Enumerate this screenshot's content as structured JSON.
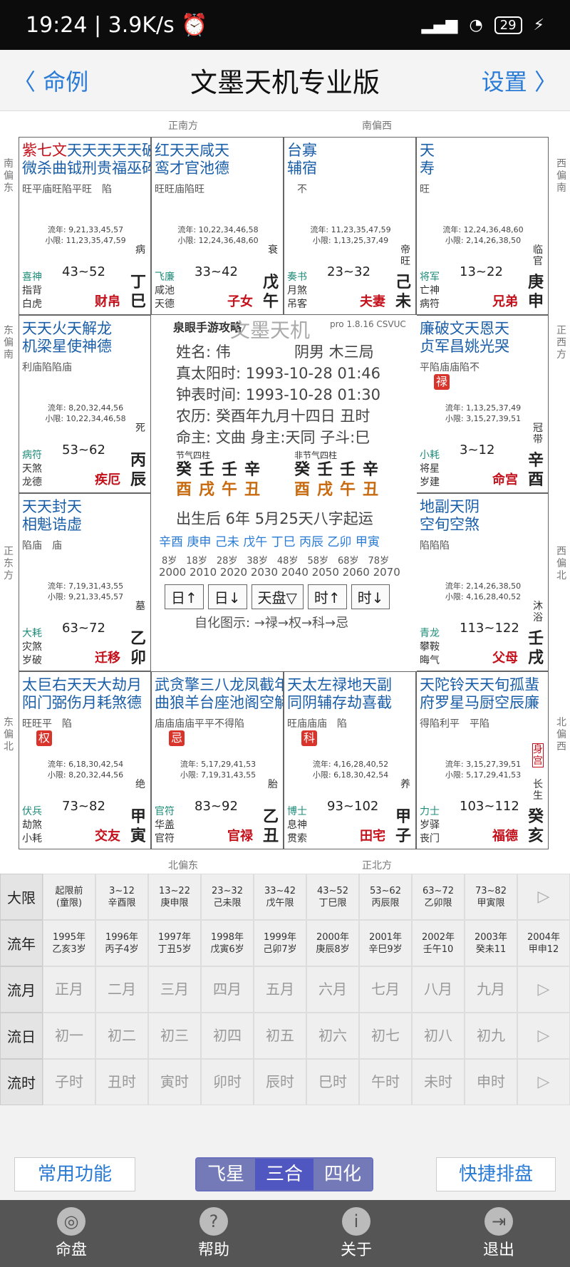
{
  "status": {
    "time": "19:24",
    "speed": "3.9K/s",
    "battery": "29"
  },
  "nav": {
    "back": "命例",
    "title": "文墨天机专业版",
    "settings": "设置"
  },
  "dirs": {
    "top1": "正南方",
    "top2": "南偏西",
    "bot1": "北偏东",
    "bot2": "正北方",
    "l1": "南偏东",
    "l2": "东偏南",
    "l3": "正东方",
    "l4": "东偏北",
    "r1": "西偏南",
    "r2": "正西方",
    "r3": "西偏北",
    "r4": "北偏西"
  },
  "cells": [
    {
      "main": "紫七文",
      "stars": "天天天天天破",
      "sub": "微杀曲钺刑贵福巫碎",
      "bright": "旺平庙旺陷平旺　陷",
      "flow1": "流年: 9,21,33,45,57",
      "flow2": "小限: 11,23,35,47,59",
      "range": "43~52",
      "g1": "喜神",
      "g2": "指背",
      "g3": "白虎",
      "pal": "财帛",
      "gz": "丁巳",
      "sm": "病"
    },
    {
      "main": "",
      "stars": "红天天咸天",
      "sub": "鸾才官池德",
      "bright": "旺旺庙陷旺",
      "flow1": "流年: 10,22,34,46,58",
      "flow2": "小限: 12,24,36,48,60",
      "range": "33~42",
      "g1": "飞廉",
      "g2": "咸池",
      "g3": "天德",
      "pal": "子女",
      "gz": "戊午",
      "sm": "衰"
    },
    {
      "main": "",
      "stars": "台寡",
      "sub": "辅宿",
      "bright": "　不",
      "flow1": "流年: 11,23,35,47,59",
      "flow2": "小限: 1,13,25,37,49",
      "range": "23~32",
      "g1": "奏书",
      "g2": "月煞",
      "g3": "吊客",
      "pal": "夫妻",
      "gz": "己未",
      "sm": "帝旺"
    },
    {
      "main": "",
      "stars": "天",
      "sub": "寿",
      "bright": "旺",
      "flow1": "流年: 12,24,36,48,60",
      "flow2": "小限: 2,14,26,38,50",
      "range": "13~22",
      "g1": "将军",
      "g2": "亡神",
      "g3": "病符",
      "pal": "兄弟",
      "gz": "庚申",
      "sm": "临官"
    },
    {
      "main": "",
      "stars": "天天火天解龙",
      "sub": "机梁星使神德",
      "bright": "利庙陷陷庙",
      "flow1": "流年: 8,20,32,44,56",
      "flow2": "小限: 10,22,34,46,58",
      "range": "53~62",
      "g1": "病符",
      "g2": "天煞",
      "g3": "龙德",
      "pal": "疾厄",
      "gz": "丙辰",
      "sm": "死"
    },
    {
      "main": "",
      "stars": "廉破文天恩天",
      "sub": "贞军昌姚光哭",
      "bright": "平陷庙庙陷不",
      "flow1": "流年: 1,13,25,37,49",
      "flow2": "小限: 3,15,27,39,51",
      "range": "3~12",
      "g1": "小耗",
      "g2": "将星",
      "g3": "岁建",
      "pal": "命宫",
      "gz": "辛酉",
      "sm": "冠带",
      "badge": "禄"
    },
    {
      "main": "",
      "stars": "天天封天",
      "sub": "相魁诰虚",
      "bright": "陷庙　庙",
      "flow1": "流年: 7,19,31,43,55",
      "flow2": "小限: 9,21,33,45,57",
      "range": "63~72",
      "g1": "大耗",
      "g2": "灾煞",
      "g3": "岁破",
      "pal": "迁移",
      "gz": "乙卯",
      "sm": "墓"
    },
    {
      "main": "",
      "stars": "地副天阴",
      "sub": "空旬空煞",
      "bright": "陷陷陷",
      "flow1": "流年: 2,14,26,38,50",
      "flow2": "小限: 4,16,28,40,52",
      "range": "113~122",
      "g1": "青龙",
      "g2": "攀鞍",
      "g3": "晦气",
      "pal": "父母",
      "gz": "壬戌",
      "sm": "沐浴"
    },
    {
      "main": "",
      "stars": "太巨右天天大劫月",
      "sub": "阳门弼伤月耗煞德",
      "bright": "旺旺平　陷",
      "flow1": "流年: 6,18,30,42,54",
      "flow2": "小限: 8,20,32,44,56",
      "range": "73~82",
      "g1": "伏兵",
      "g2": "劫煞",
      "g3": "小耗",
      "pal": "交友",
      "gz": "甲寅",
      "sm": "绝",
      "badge": "权"
    },
    {
      "main": "",
      "stars": "武贪擎三八龙凤截年华",
      "sub": "曲狼羊台座池阁空解盖",
      "bright": "庙庙庙庙平平不得陷",
      "flow1": "流年: 5,17,29,41,53",
      "flow2": "小限: 7,19,31,43,55",
      "range": "83~92",
      "g1": "官符",
      "g2": "华盖",
      "g3": "官符",
      "pal": "官禄",
      "gz": "乙丑",
      "sm": "胎",
      "badge": "忌"
    },
    {
      "main": "",
      "stars": "天太左禄地天副",
      "sub": "同阴辅存劫喜截",
      "bright": "旺庙庙庙　陷",
      "flow1": "流年: 4,16,28,40,52",
      "flow2": "小限: 6,18,30,42,54",
      "range": "93~102",
      "g1": "博士",
      "g2": "息神",
      "g3": "贯索",
      "pal": "田宅",
      "gz": "甲子",
      "sm": "养",
      "badge": "科"
    },
    {
      "main": "",
      "stars": "天陀铃天天旬孤蜚",
      "sub": "府罗星马厨空辰廉",
      "bright": "得陷利平　平陷",
      "flow1": "流年: 3,15,27,39,51",
      "flow2": "小限: 5,17,29,41,53",
      "range": "103~112",
      "g1": "力士",
      "g2": "岁驿",
      "g3": "丧门",
      "pal": "福德",
      "gz": "癸亥",
      "sm": "长生",
      "tag": "身宫"
    }
  ],
  "center": {
    "logo": "泉眼手游攻略",
    "watermark": "文墨天机",
    "version": "pro 1.8.16 CSVUC",
    "name": "姓名: 伟",
    "gender": "阴男 木三局",
    "solar": "真太阳时: 1993-10-28 01:46",
    "clock": "钟表时间: 1993-10-28 01:30",
    "lunar": "农历: 癸酉年九月十四日 丑时",
    "master": "命主: 文曲 身主:天同 子斗:巳",
    "p1label": "节气四柱",
    "p2label": "非节气四柱",
    "p1top": "癸壬壬辛",
    "p1bot": "酉戌午丑",
    "p2top": "癸壬壬辛",
    "p2bot": "酉戌午丑",
    "luck": "出生后 6年 5月25天八字起运",
    "dayun": "辛酉 庚申 己未 戊午 丁巳 丙辰 乙卯 甲寅",
    "ages": "8岁　18岁　28岁　38岁　48岁　58岁　68岁　78岁",
    "years": "2000 2010 2020 2030 2040 2050 2060 2070",
    "btn1": "日↑",
    "btn2": "日↓",
    "btn3": "天盘▽",
    "btn4": "时↑",
    "btn5": "时↓",
    "hua": "自化图示: →禄→权→科→忌"
  },
  "table": {
    "rows": [
      {
        "head": "大限",
        "cells": [
          [
            "起限前",
            "(童限)"
          ],
          [
            "3~12",
            "辛酉限"
          ],
          [
            "13~22",
            "庚申限"
          ],
          [
            "23~32",
            "己未限"
          ],
          [
            "33~42",
            "戊午限"
          ],
          [
            "43~52",
            "丁巳限"
          ],
          [
            "53~62",
            "丙辰限"
          ],
          [
            "63~72",
            "乙卯限"
          ],
          [
            "73~82",
            "甲寅限"
          ]
        ],
        "tail": "▷"
      },
      {
        "head": "流年",
        "cells": [
          [
            "1995年",
            "乙亥3岁"
          ],
          [
            "1996年",
            "丙子4岁"
          ],
          [
            "1997年",
            "丁丑5岁"
          ],
          [
            "1998年",
            "戊寅6岁"
          ],
          [
            "1999年",
            "己卯7岁"
          ],
          [
            "2000年",
            "庚辰8岁"
          ],
          [
            "2001年",
            "辛巳9岁"
          ],
          [
            "2002年",
            "壬午10"
          ],
          [
            "2003年",
            "癸未11"
          ]
        ],
        "tail2": [
          "2004年",
          "甲申12"
        ]
      },
      {
        "head": "流月",
        "cells": [
          "正月",
          "二月",
          "三月",
          "四月",
          "五月",
          "六月",
          "七月",
          "八月",
          "九月"
        ],
        "tail": "▷"
      },
      {
        "head": "流日",
        "cells": [
          "初一",
          "初二",
          "初三",
          "初四",
          "初五",
          "初六",
          "初七",
          "初八",
          "初九"
        ],
        "tail": "▷"
      },
      {
        "head": "流时",
        "cells": [
          "子时",
          "丑时",
          "寅时",
          "卯时",
          "辰时",
          "巳时",
          "午时",
          "未时",
          "申时"
        ],
        "tail": "▷"
      }
    ]
  },
  "bottom": {
    "common": "常用功能",
    "seg1": "飞星",
    "seg2": "三合",
    "seg3": "四化",
    "quick": "快捷排盘"
  },
  "tabs": [
    {
      "label": "命盘",
      "icon": "◎"
    },
    {
      "label": "帮助",
      "icon": "?"
    },
    {
      "label": "关于",
      "icon": "i"
    },
    {
      "label": "退出",
      "icon": "⇥"
    }
  ]
}
